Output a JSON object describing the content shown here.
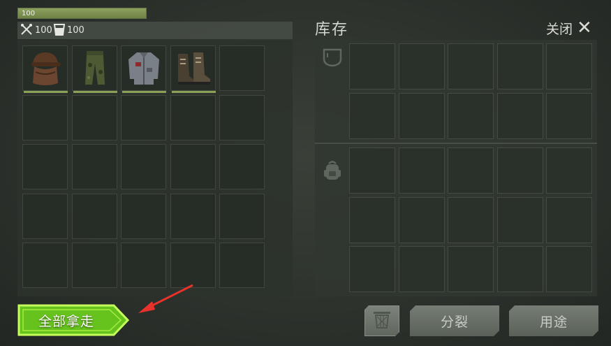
{
  "health": {
    "text": "100",
    "fraction": 1.0
  },
  "stats": {
    "food_value": "100",
    "water_value": "100",
    "food_icon": "fork-knife-icon",
    "water_icon": "cup-icon"
  },
  "loot_items": [
    {
      "name": "hat-with-scarf",
      "icon": "hat-scarf-icon"
    },
    {
      "name": "camo-pants",
      "icon": "pants-icon"
    },
    {
      "name": "jacket",
      "icon": "jacket-icon"
    },
    {
      "name": "boots",
      "icon": "boots-icon"
    }
  ],
  "inventory": {
    "title": "库存",
    "close_label": "关闭"
  },
  "buttons": {
    "take_all": "全部拿走",
    "split": "分裂",
    "use": "用途"
  },
  "colors": {
    "accent_green": "#8aa056",
    "take_all_green": "#7ed321",
    "arrow_red": "#e8322b"
  }
}
